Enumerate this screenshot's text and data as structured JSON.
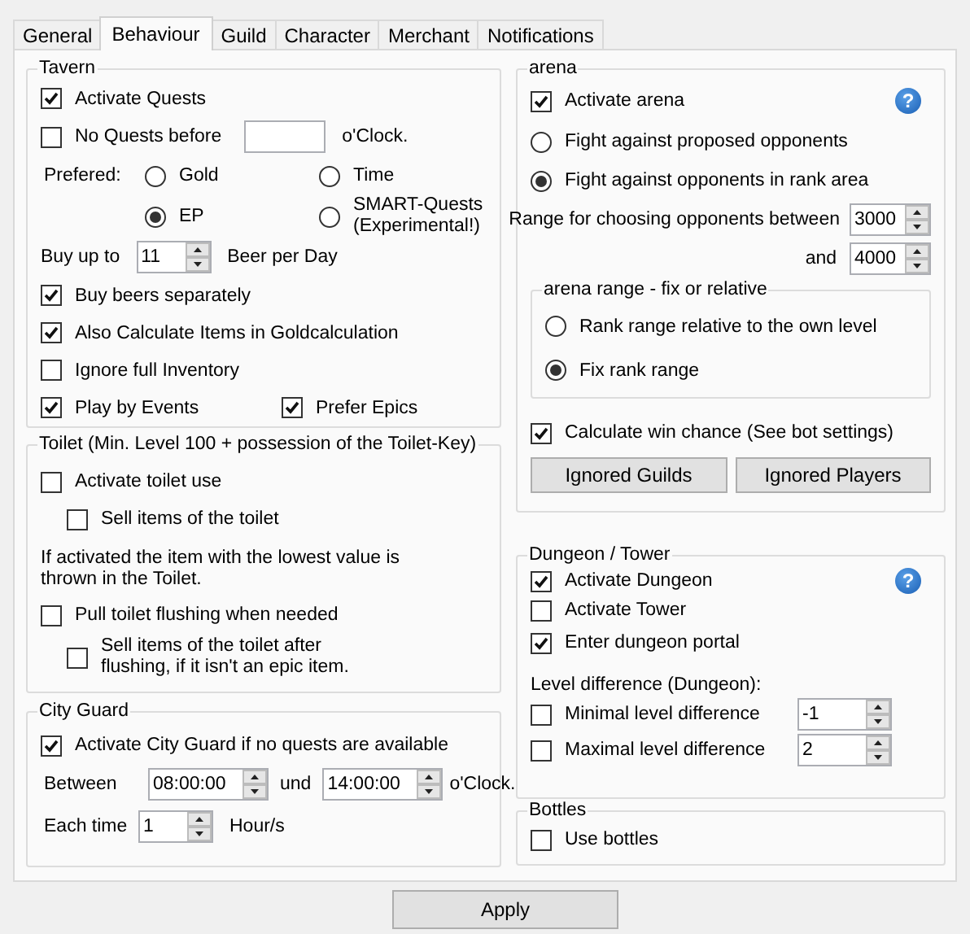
{
  "tabs": [
    {
      "label": "General",
      "selected": false
    },
    {
      "label": "Behaviour",
      "selected": true
    },
    {
      "label": "Guild",
      "selected": false
    },
    {
      "label": "Character",
      "selected": false
    },
    {
      "label": "Merchant",
      "selected": false
    },
    {
      "label": "Notifications",
      "selected": false
    }
  ],
  "tavern": {
    "title": "Tavern",
    "activate_quests": {
      "label": "Activate Quests",
      "checked": true
    },
    "no_quests_before": {
      "label": "No Quests before",
      "checked": false,
      "suffix": "o'Clock."
    },
    "preferred": {
      "label": "Prefered:",
      "options": [
        {
          "label": "Gold",
          "selected": false
        },
        {
          "label": "EP",
          "selected": true
        },
        {
          "label": "Time",
          "selected": false
        },
        {
          "label": "SMART-Quests (Experimental!)",
          "selected": false
        }
      ]
    },
    "beer": {
      "label": "Buy up to",
      "value": "11",
      "suffix": "Beer per Day"
    },
    "options": [
      {
        "label": "Buy beers separately",
        "checked": true
      },
      {
        "label": "Also Calculate Items in Goldcalculation",
        "checked": true
      },
      {
        "label": "Ignore full Inventory",
        "checked": false
      }
    ],
    "events": [
      {
        "label": "Play by Events",
        "checked": true
      },
      {
        "label": "Prefer Epics",
        "checked": true
      }
    ]
  },
  "toilet": {
    "title": "Toilet (Min. Level 100 + possession of the Toilet-Key)",
    "use": {
      "label": "Activate toilet use",
      "checked": false,
      "children": [
        {
          "label": "Sell items of the toilet",
          "checked": false
        }
      ]
    },
    "note": "If activated the item with the lowest value is thrown in the Toilet.",
    "flush": {
      "label": "Pull toilet flushing when needed",
      "checked": false,
      "children": [
        {
          "label": "Sell items of the toilet after flushing, if it isn't an epic item.",
          "checked": false
        }
      ]
    }
  },
  "city_guard": {
    "title": "City Guard",
    "activate": {
      "label": "Activate City Guard if no quests are available",
      "checked": true
    },
    "between": {
      "label": "Between",
      "from": "08:00:00",
      "joiner": "und",
      "to": "14:00:00",
      "suffix": "o'Clock."
    },
    "interval": {
      "label": "Each time",
      "value": "1",
      "suffix": "Hour/s"
    }
  },
  "arena": {
    "title": "arena",
    "help": "?",
    "activate": {
      "label": "Activate arena",
      "checked": true
    },
    "modes": [
      {
        "label": "Fight against proposed opponents",
        "selected": false
      },
      {
        "label": "Fight against opponents in rank area",
        "selected": true
      }
    ],
    "range": {
      "label": "Range for choosing opponents between",
      "from": "3000",
      "joiner": "and",
      "to": "4000"
    },
    "range_type": {
      "title": "arena range - fix or relative",
      "options": [
        {
          "label": "Rank range relative to the own level",
          "selected": false
        },
        {
          "label": "Fix rank range",
          "selected": true
        }
      ]
    },
    "win_chance": {
      "label": "Calculate win chance (See bot settings)",
      "checked": true
    },
    "buttons": [
      "Ignored Guilds",
      "Ignored Players"
    ]
  },
  "dungeon": {
    "title": "Dungeon / Tower",
    "help": "?",
    "options": [
      {
        "label": "Activate Dungeon",
        "checked": true
      },
      {
        "label": "Activate Tower",
        "checked": false
      },
      {
        "label": "Enter dungeon portal",
        "checked": true
      }
    ],
    "level_label": "Level difference (Dungeon):",
    "levels": [
      {
        "label": "Minimal level difference",
        "checked": false,
        "value": "-1"
      },
      {
        "label": "Maximal level difference",
        "checked": false,
        "value": "2"
      }
    ]
  },
  "bottles": {
    "title": "Bottles",
    "use": {
      "label": "Use bottles",
      "checked": false
    }
  },
  "apply": "Apply"
}
